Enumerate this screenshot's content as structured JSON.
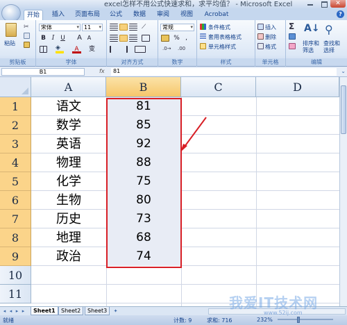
{
  "window": {
    "title": "excel怎样不用公式快速求和，求平均值？ - Microsoft Excel"
  },
  "tabs": [
    "开始",
    "插入",
    "页面布局",
    "公式",
    "数据",
    "审阅",
    "视图",
    "Acrobat"
  ],
  "ribbon": {
    "clipboard": {
      "paste": "粘贴",
      "label": "剪贴板"
    },
    "font": {
      "name": "宋体",
      "size": "11",
      "bold": "B",
      "italic": "I",
      "underline": "U",
      "grow": "A",
      "shrink": "A",
      "color_a": "A",
      "phonetic": "变",
      "label": "字体"
    },
    "alignment": {
      "label": "对齐方式"
    },
    "number": {
      "format": "常规",
      "percent": "%",
      "comma": ",",
      "label": "数字"
    },
    "styles": {
      "conditional": "条件格式",
      "table": "套用表格格式",
      "cell": "单元格样式",
      "label": "样式"
    },
    "cells": {
      "insert": "插入",
      "delete": "删除",
      "format": "格式",
      "label": "单元格"
    },
    "editing": {
      "sum": "Σ",
      "sort": "排序和",
      "sort2": "筛选",
      "find": "查找和",
      "find2": "选择",
      "label": "编辑"
    }
  },
  "formula_bar": {
    "name_box": "B1",
    "fx": "fx",
    "content": "81"
  },
  "columns": [
    "A",
    "B",
    "C",
    "D"
  ],
  "rows": [
    {
      "num": "1",
      "a": "语文",
      "b": "81"
    },
    {
      "num": "2",
      "a": "数学",
      "b": "85"
    },
    {
      "num": "3",
      "a": "英语",
      "b": "92"
    },
    {
      "num": "4",
      "a": "物理",
      "b": "88"
    },
    {
      "num": "5",
      "a": "化学",
      "b": "75"
    },
    {
      "num": "6",
      "a": "生物",
      "b": "80"
    },
    {
      "num": "7",
      "a": "历史",
      "b": "73"
    },
    {
      "num": "8",
      "a": "地理",
      "b": "68"
    },
    {
      "num": "9",
      "a": "政治",
      "b": "74"
    },
    {
      "num": "10",
      "a": "",
      "b": ""
    },
    {
      "num": "11",
      "a": "",
      "b": ""
    }
  ],
  "sheets": [
    "Sheet1",
    "Sheet2",
    "Sheet3"
  ],
  "status": {
    "mode": "就绪",
    "count": "计数: 9",
    "sum": "求和: 716",
    "zoom": "232%"
  },
  "watermark": {
    "text": "我爱IT技术网",
    "url": "www.52ij.com"
  },
  "colors": {
    "selection_border": "#d81f26",
    "row_header_selected": "#fbd48a"
  }
}
